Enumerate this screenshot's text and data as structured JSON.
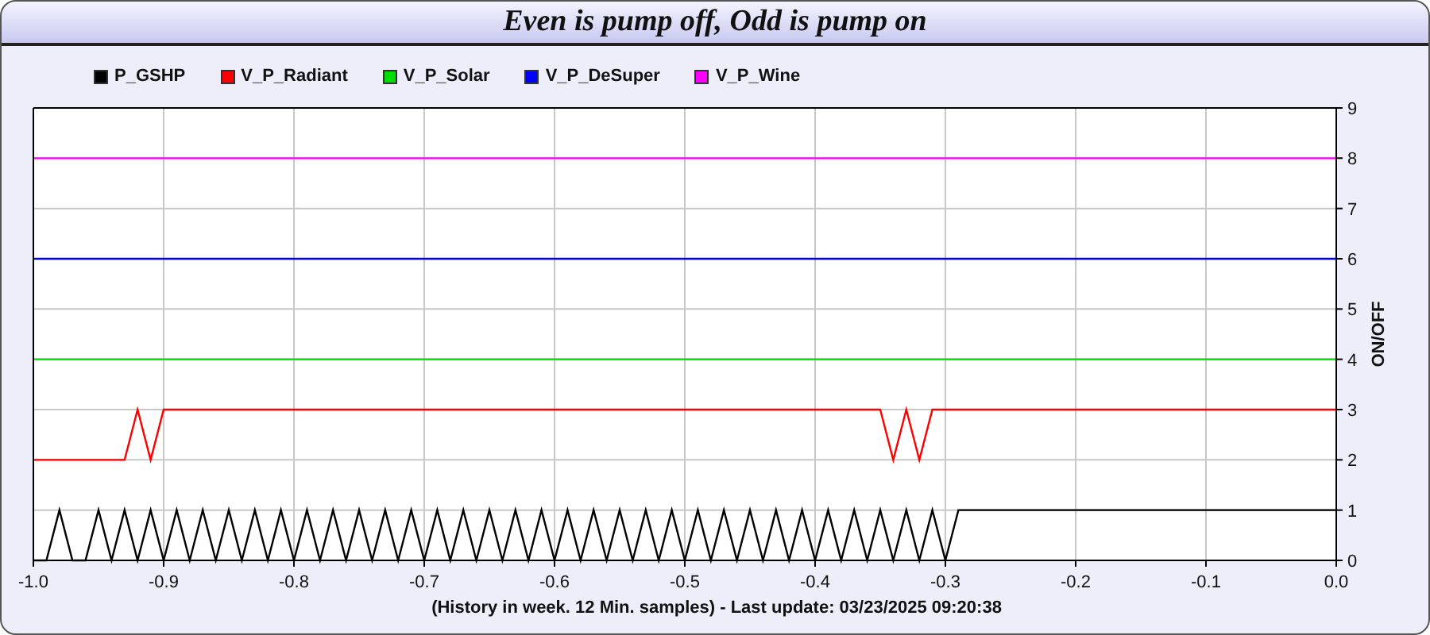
{
  "panel": {
    "title": "Even is pump off, Odd is pump on"
  },
  "chart_data": {
    "type": "line",
    "ylabel": "ON/OFF",
    "xlabel": "(History in week. 12 Min. samples) - Last update: 03/23/2025 09:20:38",
    "grid": true,
    "xlim": [
      -1,
      0
    ],
    "ylim": [
      0,
      9
    ],
    "xticks": [
      {
        "value": -1,
        "label": "-1.0"
      },
      {
        "value": -0.9,
        "label": "-0.9"
      },
      {
        "value": -0.8,
        "label": "-0.8"
      },
      {
        "value": -0.7,
        "label": "-0.7"
      },
      {
        "value": -0.6,
        "label": "-0.6"
      },
      {
        "value": -0.5,
        "label": "-0.5"
      },
      {
        "value": -0.4,
        "label": "-0.4"
      },
      {
        "value": -0.3,
        "label": "-0.3"
      },
      {
        "value": -0.2,
        "label": "-0.2"
      },
      {
        "value": -0.1,
        "label": "-0.1"
      },
      {
        "value": 0,
        "label": "0.0"
      }
    ],
    "yticks": [
      0,
      1,
      2,
      3,
      4,
      5,
      6,
      7,
      8,
      9
    ],
    "x": [
      -1.0,
      -0.99,
      -0.98,
      -0.97,
      -0.96,
      -0.95,
      -0.94,
      -0.93,
      -0.92,
      -0.91,
      -0.9,
      -0.89,
      -0.88,
      -0.87,
      -0.86,
      -0.85,
      -0.84,
      -0.83,
      -0.82,
      -0.81,
      -0.8,
      -0.79,
      -0.78,
      -0.77,
      -0.76,
      -0.75,
      -0.74,
      -0.73,
      -0.72,
      -0.71,
      -0.7,
      -0.69,
      -0.68,
      -0.67,
      -0.66,
      -0.65,
      -0.64,
      -0.63,
      -0.62,
      -0.61,
      -0.6,
      -0.59,
      -0.58,
      -0.57,
      -0.56,
      -0.55,
      -0.54,
      -0.53,
      -0.52,
      -0.51,
      -0.5,
      -0.49,
      -0.48,
      -0.47,
      -0.46,
      -0.45,
      -0.44,
      -0.43,
      -0.42,
      -0.41,
      -0.4,
      -0.39,
      -0.38,
      -0.37,
      -0.36,
      -0.35,
      -0.34,
      -0.33,
      -0.32,
      -0.31,
      -0.3,
      -0.29,
      -0.28,
      -0.27,
      -0.26,
      -0.25,
      -0.24,
      -0.23,
      -0.22,
      -0.21,
      -0.2,
      -0.19,
      -0.18,
      -0.17,
      -0.16,
      -0.15,
      -0.14,
      -0.13,
      -0.12,
      -0.11,
      -0.1,
      -0.09,
      -0.08,
      -0.07,
      -0.06,
      -0.05,
      -0.04,
      -0.03,
      -0.02,
      -0.01,
      0.0
    ],
    "series": [
      {
        "name": "P_GSHP",
        "color": "#000000",
        "values": [
          0,
          0,
          1,
          0,
          0,
          1,
          0,
          1,
          0,
          1,
          0,
          1,
          0,
          1,
          0,
          1,
          0,
          1,
          0,
          1,
          0,
          1,
          0,
          1,
          0,
          1,
          0,
          1,
          0,
          1,
          0,
          1,
          0,
          1,
          0,
          1,
          0,
          1,
          0,
          1,
          0,
          1,
          0,
          1,
          0,
          1,
          0,
          1,
          0,
          1,
          0,
          1,
          0,
          1,
          0,
          1,
          0,
          1,
          0,
          1,
          0,
          1,
          0,
          1,
          0,
          1,
          0,
          1,
          0,
          1,
          0,
          1,
          1,
          1,
          1,
          1,
          1,
          1,
          1,
          1,
          1,
          1,
          1,
          1,
          1,
          1,
          1,
          1,
          1,
          1,
          1,
          1,
          1,
          1,
          1,
          1,
          1,
          1,
          1,
          1,
          1
        ]
      },
      {
        "name": "V_P_Radiant",
        "color": "#ff0000",
        "values": [
          2,
          2,
          2,
          2,
          2,
          2,
          2,
          2,
          3,
          2,
          3,
          3,
          3,
          3,
          3,
          3,
          3,
          3,
          3,
          3,
          3,
          3,
          3,
          3,
          3,
          3,
          3,
          3,
          3,
          3,
          3,
          3,
          3,
          3,
          3,
          3,
          3,
          3,
          3,
          3,
          3,
          3,
          3,
          3,
          3,
          3,
          3,
          3,
          3,
          3,
          3,
          3,
          3,
          3,
          3,
          3,
          3,
          3,
          3,
          3,
          3,
          3,
          3,
          3,
          3,
          3,
          2,
          3,
          2,
          3,
          3,
          3,
          3,
          3,
          3,
          3,
          3,
          3,
          3,
          3,
          3,
          3,
          3,
          3,
          3,
          3,
          3,
          3,
          3,
          3,
          3,
          3,
          3,
          3,
          3,
          3,
          3,
          3,
          3,
          3,
          3
        ]
      },
      {
        "name": "V_P_Solar",
        "color": "#00dd00",
        "values": [
          4,
          4,
          4,
          4,
          4,
          4,
          4,
          4,
          4,
          4,
          4,
          4,
          4,
          4,
          4,
          4,
          4,
          4,
          4,
          4,
          4,
          4,
          4,
          4,
          4,
          4,
          4,
          4,
          4,
          4,
          4,
          4,
          4,
          4,
          4,
          4,
          4,
          4,
          4,
          4,
          4,
          4,
          4,
          4,
          4,
          4,
          4,
          4,
          4,
          4,
          4,
          4,
          4,
          4,
          4,
          4,
          4,
          4,
          4,
          4,
          4,
          4,
          4,
          4,
          4,
          4,
          4,
          4,
          4,
          4,
          4,
          4,
          4,
          4,
          4,
          4,
          4,
          4,
          4,
          4,
          4,
          4,
          4,
          4,
          4,
          4,
          4,
          4,
          4,
          4,
          4,
          4,
          4,
          4,
          4,
          4,
          4,
          4,
          4,
          4,
          4
        ]
      },
      {
        "name": "V_P_DeSuper",
        "color": "#0000ff",
        "values": [
          6,
          6,
          6,
          6,
          6,
          6,
          6,
          6,
          6,
          6,
          6,
          6,
          6,
          6,
          6,
          6,
          6,
          6,
          6,
          6,
          6,
          6,
          6,
          6,
          6,
          6,
          6,
          6,
          6,
          6,
          6,
          6,
          6,
          6,
          6,
          6,
          6,
          6,
          6,
          6,
          6,
          6,
          6,
          6,
          6,
          6,
          6,
          6,
          6,
          6,
          6,
          6,
          6,
          6,
          6,
          6,
          6,
          6,
          6,
          6,
          6,
          6,
          6,
          6,
          6,
          6,
          6,
          6,
          6,
          6,
          6,
          6,
          6,
          6,
          6,
          6,
          6,
          6,
          6,
          6,
          6,
          6,
          6,
          6,
          6,
          6,
          6,
          6,
          6,
          6,
          6,
          6,
          6,
          6,
          6,
          6,
          6,
          6,
          6,
          6,
          6
        ]
      },
      {
        "name": "V_P_Wine",
        "color": "#ff00ff",
        "values": [
          8,
          8,
          8,
          8,
          8,
          8,
          8,
          8,
          8,
          8,
          8,
          8,
          8,
          8,
          8,
          8,
          8,
          8,
          8,
          8,
          8,
          8,
          8,
          8,
          8,
          8,
          8,
          8,
          8,
          8,
          8,
          8,
          8,
          8,
          8,
          8,
          8,
          8,
          8,
          8,
          8,
          8,
          8,
          8,
          8,
          8,
          8,
          8,
          8,
          8,
          8,
          8,
          8,
          8,
          8,
          8,
          8,
          8,
          8,
          8,
          8,
          8,
          8,
          8,
          8,
          8,
          8,
          8,
          8,
          8,
          8,
          8,
          8,
          8,
          8,
          8,
          8,
          8,
          8,
          8,
          8,
          8,
          8,
          8,
          8,
          8,
          8,
          8,
          8,
          8,
          8,
          8,
          8,
          8,
          8,
          8,
          8,
          8,
          8,
          8,
          8
        ]
      }
    ]
  }
}
